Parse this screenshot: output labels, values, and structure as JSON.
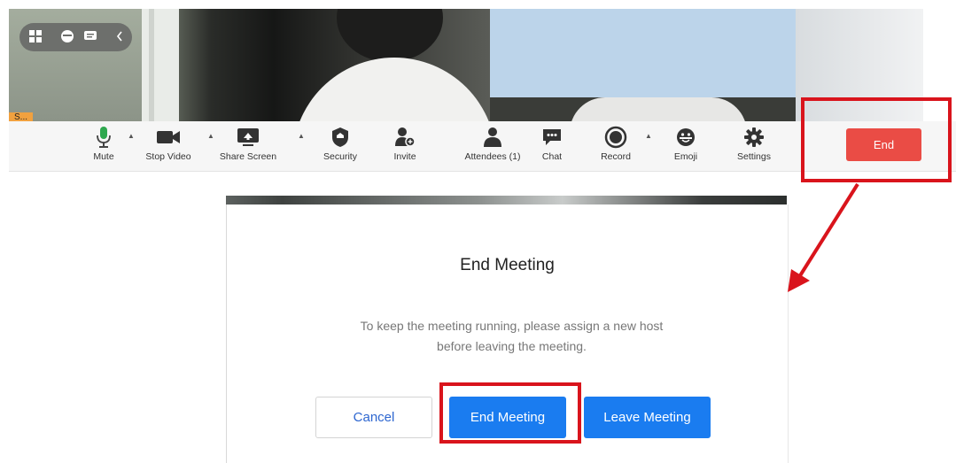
{
  "video": {
    "view_icons": [
      "gallery-view-icon",
      "emoji-face-icon",
      "chat-bubble-icon",
      "collapse-arrow-icon"
    ],
    "name_tag": "S..."
  },
  "toolbar": {
    "items": [
      {
        "key": "mute",
        "label": "Mute",
        "icon": "microphone-icon"
      },
      {
        "key": "stop_video",
        "label": "Stop Video",
        "icon": "video-camera-icon"
      },
      {
        "key": "share_screen",
        "label": "Share Screen",
        "icon": "share-screen-icon"
      },
      {
        "key": "security",
        "label": "Security",
        "icon": "shield-icon"
      },
      {
        "key": "invite",
        "label": "Invite",
        "icon": "add-user-icon"
      },
      {
        "key": "attendees",
        "label": "Attendees (1)",
        "icon": "attendees-icon"
      },
      {
        "key": "chat",
        "label": "Chat",
        "icon": "chat-icon"
      },
      {
        "key": "record",
        "label": "Record",
        "icon": "record-icon"
      },
      {
        "key": "emoji",
        "label": "Emoji",
        "icon": "emoji-icon"
      },
      {
        "key": "settings",
        "label": "Settings",
        "icon": "gear-icon"
      }
    ],
    "end_label": "End"
  },
  "dialog": {
    "title": "End Meeting",
    "message_line1": "To keep the meeting running, please assign a new host",
    "message_line2": "before leaving the meeting.",
    "cancel_label": "Cancel",
    "end_meeting_label": "End Meeting",
    "leave_meeting_label": "Leave Meeting"
  },
  "colors": {
    "end_button": "#ea4c45",
    "primary_button": "#1a7cf0",
    "annotation_red": "#d9141c",
    "mic_green": "#2fa84f"
  }
}
